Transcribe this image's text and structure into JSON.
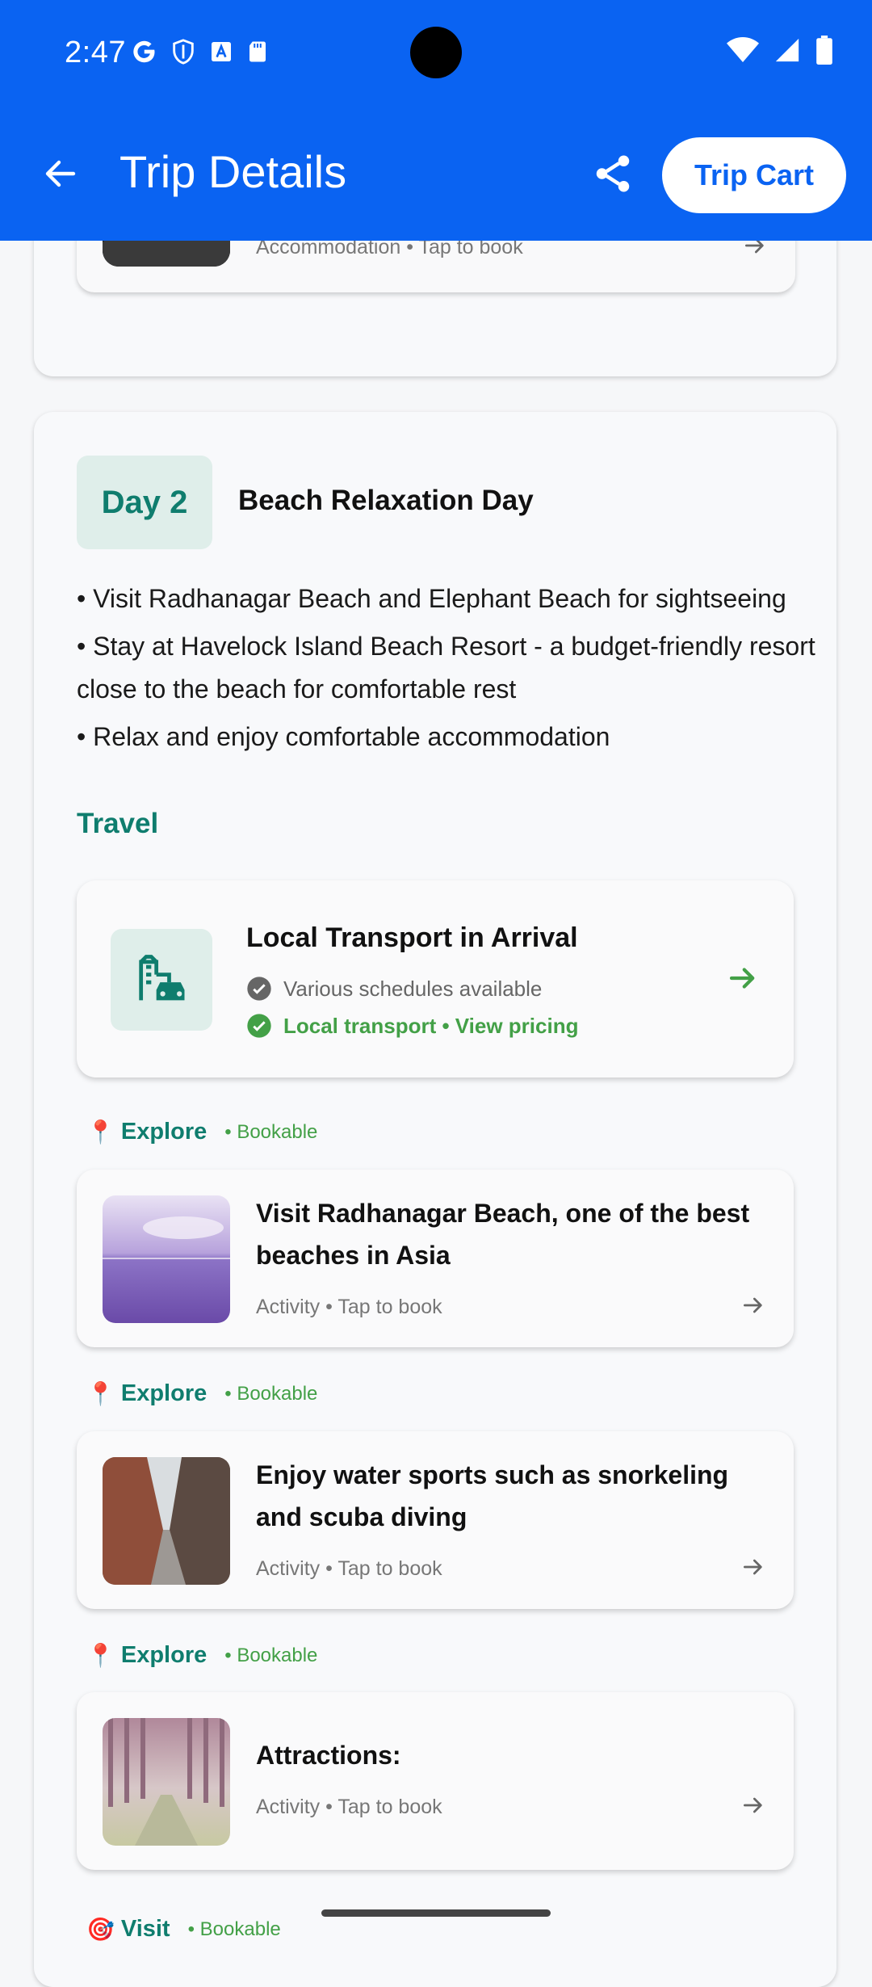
{
  "status_bar": {
    "time": "2:47"
  },
  "toolbar": {
    "title": "Trip Details",
    "cart_label": "Trip Cart"
  },
  "day1": {
    "accommodation_subtitle": "Accommodation • Tap to book"
  },
  "day2": {
    "badge": "Day 2",
    "title": "Beach Relaxation Day",
    "bullets": [
      "• Visit Radhanagar Beach and Elephant Beach for sightseeing",
      "• Stay at Havelock Island Beach Resort - a budget-friendly resort close to the beach for comfortable rest",
      "• Relax and enjoy comfortable accommodation"
    ],
    "travel_heading": "Travel",
    "transport": {
      "title": "Local Transport in Arrival",
      "line1": "Various schedules available",
      "line2": "Local transport • View pricing"
    },
    "activities": [
      {
        "section": "Explore",
        "tag": "• Bookable",
        "title": "Visit Radhanagar Beach, one of the best beaches in Asia",
        "subtitle": "Activity • Tap to book"
      },
      {
        "section": "Explore",
        "tag": "• Bookable",
        "title": "Enjoy water sports such as snorkeling and scuba diving",
        "subtitle": "Activity • Tap to book"
      },
      {
        "section": "Explore",
        "tag": "• Bookable",
        "title": "Attractions:",
        "subtitle": "Activity • Tap to book"
      }
    ],
    "next_section": {
      "section": "Visit",
      "tag": "• Bookable"
    }
  },
  "colors": {
    "primary": "#0a63f2",
    "teal": "#0f7d6e",
    "green": "#43a047"
  }
}
